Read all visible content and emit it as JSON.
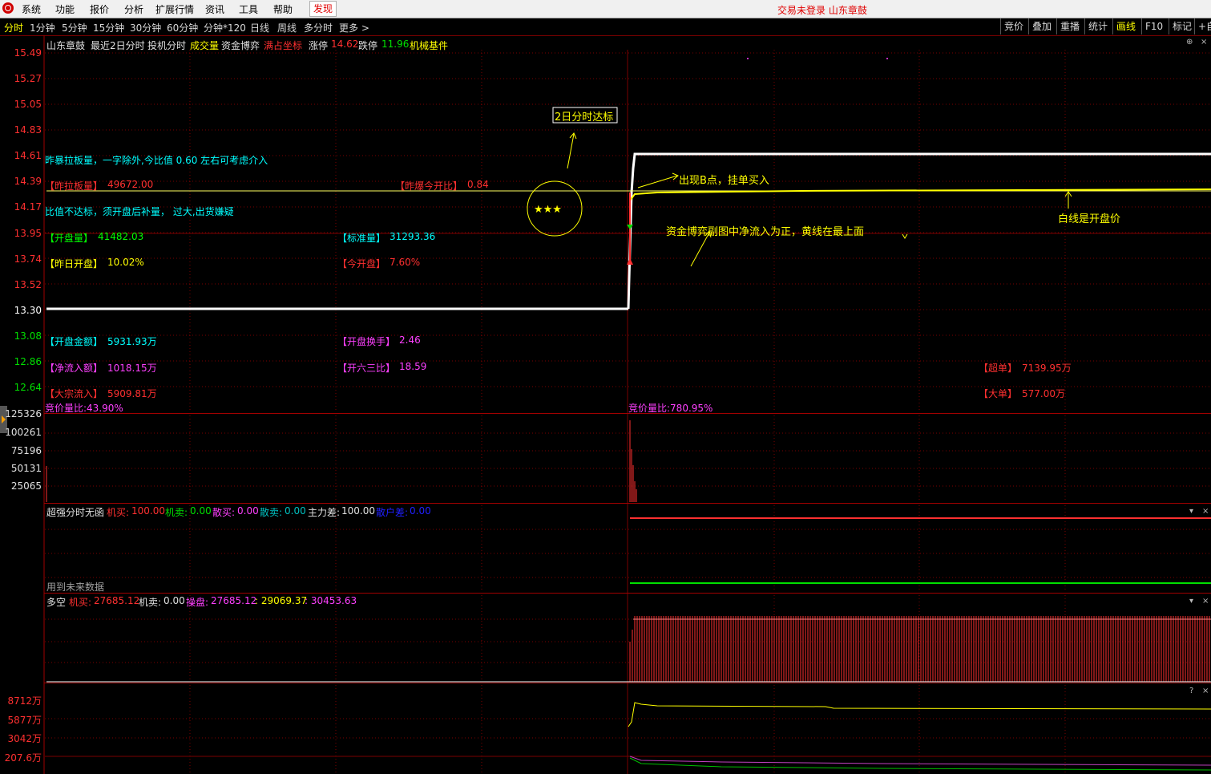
{
  "menu": {
    "items": [
      "系统",
      "功能",
      "报价",
      "分析",
      "扩展行情",
      "资讯",
      "工具",
      "帮助"
    ],
    "discover": "发现",
    "status": "交易未登录  山东章鼓"
  },
  "tabs": {
    "items": [
      "分时",
      "1分钟",
      "5分钟",
      "15分钟",
      "30分钟",
      "60分钟",
      "分钟*120",
      "日线",
      "周线",
      "多分时",
      "更多 >"
    ],
    "active": "分时",
    "right": [
      "竞价",
      "叠加",
      "重播",
      "统计",
      "画线",
      "F10",
      "标记",
      "+自"
    ],
    "right_on": "画线"
  },
  "header": {
    "name": "山东章鼓",
    "items": [
      "最近2日分时",
      "投机分时",
      "成交量",
      "资金博弈",
      "满占坐标"
    ],
    "limit_up_label": "涨停",
    "limit_up": "14.62",
    "limit_down_label": "跌停",
    "limit_down": "11.96",
    "sector": "机械基件"
  },
  "price_axis": [
    "15.49",
    "15.27",
    "15.05",
    "14.83",
    "14.61",
    "14.39",
    "14.17",
    "13.95",
    "13.74",
    "13.52",
    "13.30",
    "13.08",
    "12.86",
    "12.64"
  ],
  "vol_axis": [
    "125326",
    "100261",
    "75196",
    "50131",
    "25065"
  ],
  "fund_axis": [
    "8712万",
    "5877万",
    "3042万",
    "207.6万"
  ],
  "notes": {
    "note1": "昨暴拉板量，一字除外,今比值  0.60  左右可考虑介入",
    "note2": "比值不达标，须开盘后补量，  过大,出货嫌疑",
    "star_text": "★★★",
    "target": "2日分时达标",
    "b_point": "出现B点，挂单买入",
    "fund_note": "资金博弈副图中净流入为正，黄线在最上面",
    "white_line": "白线是开盘价"
  },
  "stats": {
    "zlb_label": "【昨拉板量】",
    "zlb": "49672.00",
    "ratio_label": "【昨爆今开比】",
    "ratio": "0.84",
    "kpl_label": "【开盘量】",
    "kpl": "41482.03",
    "bzl_label": "【标准量】",
    "bzl": "31293.36",
    "zrkp_label": "【昨日开盘】",
    "zrkp": "10.02%",
    "jkp_label": "【今开盘】",
    "jkp": "7.60%",
    "kpje_label": "【开盘金额】",
    "kpje": "5931.93万",
    "kphs_label": "【开盘换手】",
    "kphs": "2.46",
    "jlre_label": "【净流入额】",
    "jlre": "1018.15万",
    "klsb_label": "【开六三比】",
    "klsb": "18.59",
    "dzlr_label": "【大宗流入】",
    "dzlr": "5909.81万",
    "cd_label": "【超单】",
    "cd": "7139.95万",
    "dd_label": "【大单】",
    "dd": "577.00万",
    "left_overlap": "竞价量比:43.90%",
    "mid_overlap": "竞价量比:780.95%"
  },
  "ind1": {
    "title": "超强分时无函",
    "items": [
      {
        "label": "机买:",
        "value": "100.00",
        "color": "#ff3030"
      },
      {
        "label": "机卖:",
        "value": "0.00",
        "color": "#00e000"
      },
      {
        "label": "散买:",
        "value": "0.00",
        "color": "#ff40ff"
      },
      {
        "label": "散卖:",
        "value": "0.00",
        "color": "#00c0c0"
      },
      {
        "label": "主力差:",
        "value": "100.00",
        "color": "#e0e0e0"
      },
      {
        "label": "散户差:",
        "value": "0.00",
        "color": "#2020ff"
      }
    ],
    "note": "用到未来数据"
  },
  "ind2": {
    "title": "多空",
    "jm_label": "机买:",
    "jm": "27685.12",
    "jmai_label": "机卖:",
    "jmai": "0.00",
    "cp_label": "操盘:",
    "cp": "27685.12",
    "v2": ": 29069.37",
    "v3": ": 30453.63"
  },
  "controls": {
    "collapse": "▾",
    "close": "×",
    "help": "?",
    "restore": "⊕"
  },
  "colors": {
    "price": "#ffffff",
    "avg": "#ffff00",
    "grid": "#8b0000",
    "up": "#ff3030",
    "down": "#00e000",
    "note": "#00ffff"
  }
}
